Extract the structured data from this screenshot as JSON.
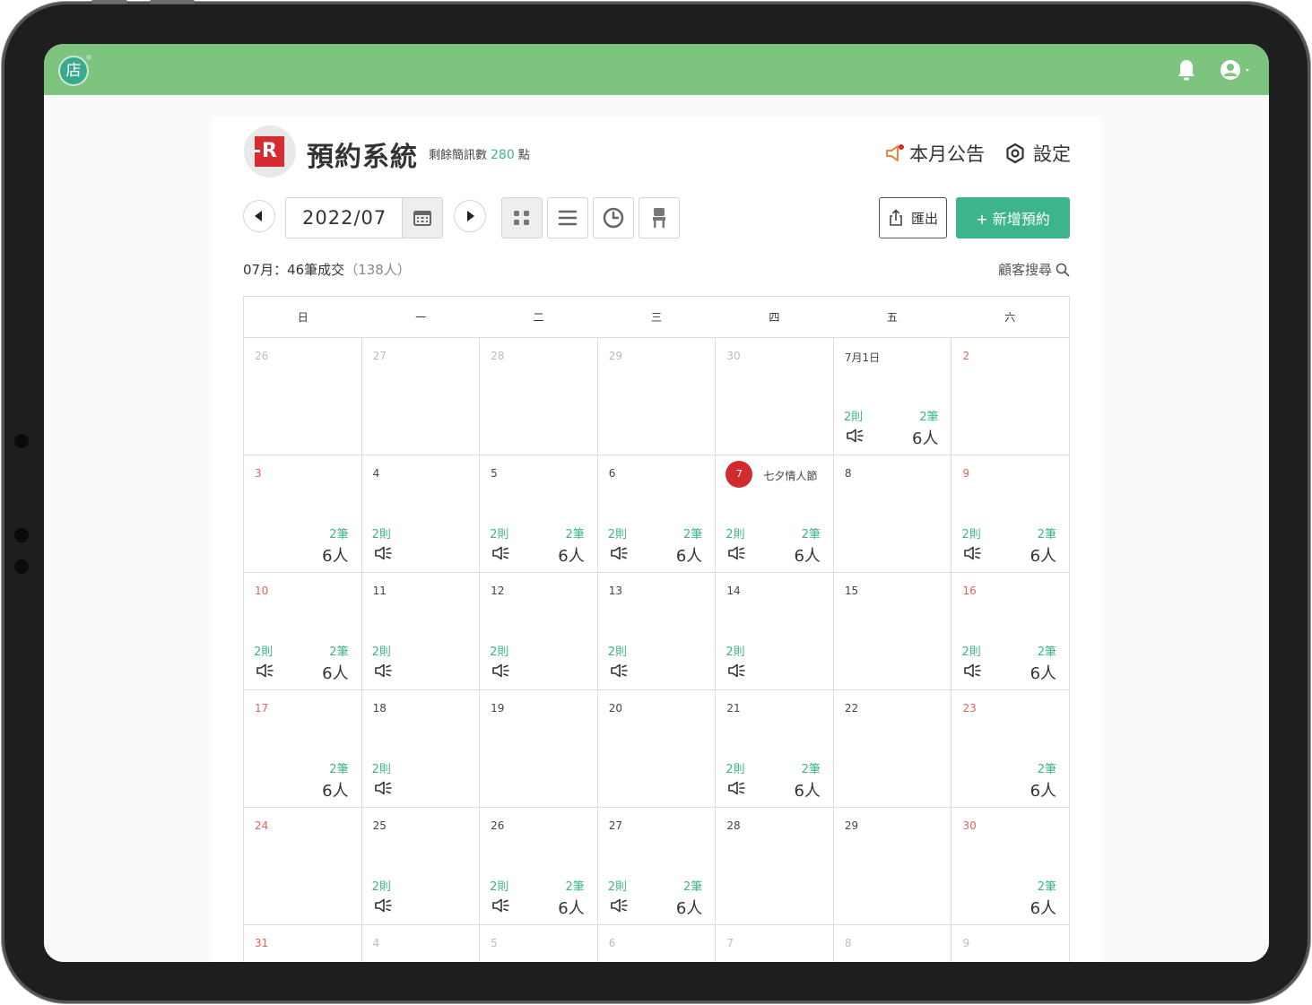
{
  "app": {
    "logo_char": "店"
  },
  "header": {
    "title": "預約系統",
    "sms_label": "剩餘簡訊數",
    "sms_points": "280",
    "sms_unit": "點",
    "brand_letter": "R",
    "announcement": "本月公告",
    "settings": "設定"
  },
  "toolbar": {
    "month": "2022/07",
    "export": "匯出",
    "add": "+ 新增預約"
  },
  "summary": {
    "text": "07月：46筆成交",
    "people": "（138人）"
  },
  "search": {
    "label": "顧客搜尋"
  },
  "calendar": {
    "weekdays": [
      "日",
      "一",
      "二",
      "三",
      "四",
      "五",
      "六"
    ],
    "weeks": [
      [
        {
          "d": "26",
          "style": "dim"
        },
        {
          "d": "27",
          "style": "dim"
        },
        {
          "d": "28",
          "style": "dim"
        },
        {
          "d": "29",
          "style": "dim"
        },
        {
          "d": "30",
          "style": "dim"
        },
        {
          "d": "7月1日",
          "notes": "2則",
          "rec": "2筆",
          "ppl": "6人"
        },
        {
          "d": "2",
          "style": "red"
        }
      ],
      [
        {
          "d": "3",
          "style": "red",
          "rec": "2筆",
          "ppl": "6人"
        },
        {
          "d": "4",
          "notes": "2則"
        },
        {
          "d": "5",
          "notes": "2則",
          "rec": "2筆",
          "ppl": "6人"
        },
        {
          "d": "6",
          "notes": "2則",
          "rec": "2筆",
          "ppl": "6人"
        },
        {
          "d": "7",
          "holiday": "七夕情人節",
          "notes": "2則",
          "rec": "2筆",
          "ppl": "6人"
        },
        {
          "d": "8"
        },
        {
          "d": "9",
          "style": "red",
          "notes": "2則",
          "rec": "2筆",
          "ppl": "6人"
        }
      ],
      [
        {
          "d": "10",
          "style": "red",
          "notes": "2則",
          "rec": "2筆",
          "ppl": "6人"
        },
        {
          "d": "11",
          "notes": "2則"
        },
        {
          "d": "12",
          "notes": "2則"
        },
        {
          "d": "13",
          "notes": "2則"
        },
        {
          "d": "14",
          "notes": "2則"
        },
        {
          "d": "15"
        },
        {
          "d": "16",
          "style": "red",
          "notes": "2則",
          "rec": "2筆",
          "ppl": "6人"
        }
      ],
      [
        {
          "d": "17",
          "style": "red",
          "rec": "2筆",
          "ppl": "6人"
        },
        {
          "d": "18",
          "notes": "2則"
        },
        {
          "d": "19"
        },
        {
          "d": "20"
        },
        {
          "d": "21",
          "notes": "2則",
          "rec": "2筆",
          "ppl": "6人"
        },
        {
          "d": "22"
        },
        {
          "d": "23",
          "style": "red",
          "rec": "2筆",
          "ppl": "6人"
        }
      ],
      [
        {
          "d": "24",
          "style": "red"
        },
        {
          "d": "25",
          "notes": "2則"
        },
        {
          "d": "26",
          "notes": "2則",
          "rec": "2筆",
          "ppl": "6人"
        },
        {
          "d": "27",
          "notes": "2則",
          "rec": "2筆",
          "ppl": "6人"
        },
        {
          "d": "28"
        },
        {
          "d": "29"
        },
        {
          "d": "30",
          "style": "red",
          "rec": "2筆",
          "ppl": "6人"
        }
      ],
      [
        {
          "d": "31",
          "style": "red"
        },
        {
          "d": "4",
          "style": "dim"
        },
        {
          "d": "5",
          "style": "dim"
        },
        {
          "d": "6",
          "style": "dim"
        },
        {
          "d": "7",
          "style": "dim"
        },
        {
          "d": "8",
          "style": "dim"
        },
        {
          "d": "9",
          "style": "dim"
        }
      ]
    ]
  },
  "colors": {
    "topbar": "#7dc47f",
    "accent": "#3db48c",
    "weekend": "#e0645a",
    "holiday": "#d02b2f"
  }
}
